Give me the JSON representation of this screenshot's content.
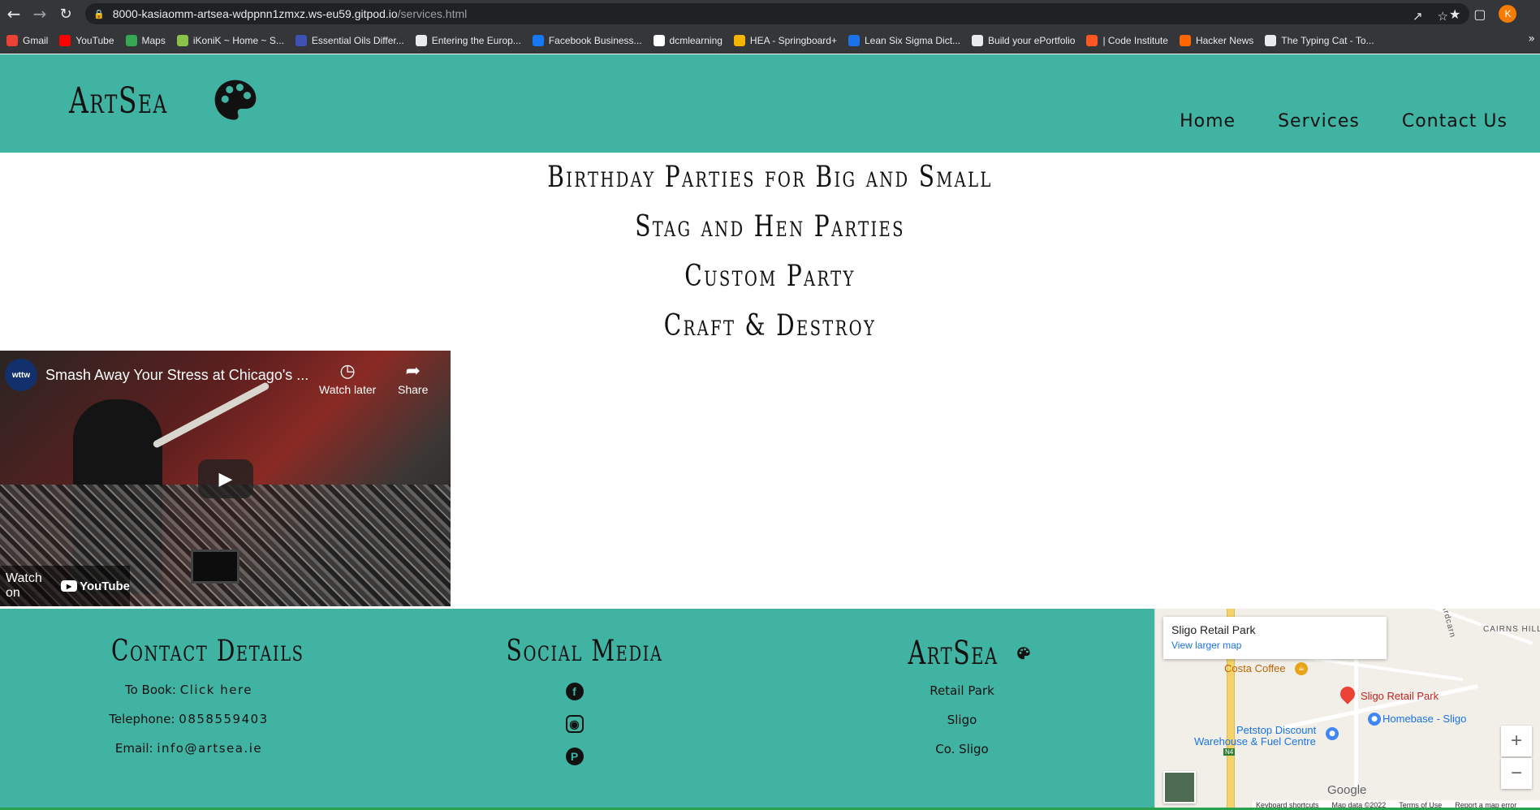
{
  "browser": {
    "url_host": "8000-kasiaomm-artsea-wdppnn1zmxz.ws-eu59.gitpod.io",
    "url_path": "/services.html",
    "profile_initial": "K",
    "bookmarks": [
      {
        "label": "Gmail",
        "color": "#ea4335"
      },
      {
        "label": "YouTube",
        "color": "#ff0000"
      },
      {
        "label": "Maps",
        "color": "#34a853"
      },
      {
        "label": "iKoniK ~ Home ~ S...",
        "color": "#8bc34a"
      },
      {
        "label": "Essential Oils Differ...",
        "color": "#3f51b5"
      },
      {
        "label": "Entering the Europ...",
        "color": "#e8eaed"
      },
      {
        "label": "Facebook Business...",
        "color": "#1877f2"
      },
      {
        "label": "dcmlearning",
        "color": "#ffffff"
      },
      {
        "label": "HEA - Springboard+",
        "color": "#f4b400"
      },
      {
        "label": "Lean Six Sigma Dict...",
        "color": "#1a73e8"
      },
      {
        "label": "Build your ePortfolio",
        "color": "#e8eaed"
      },
      {
        "label": "| Code Institute",
        "color": "#ff5722"
      },
      {
        "label": "Hacker News",
        "color": "#ff6600"
      },
      {
        "label": "The Typing Cat - To...",
        "color": "#e8eaed"
      }
    ]
  },
  "header": {
    "brand": "ArtSea",
    "nav": [
      "Home",
      "Services",
      "Contact Us"
    ]
  },
  "services": [
    "Birthday Parties for Big and Small",
    "Stag and Hen Parties",
    "Custom Party",
    "Craft & Destroy"
  ],
  "video": {
    "channel": "wttw",
    "title": "Smash Away Your Stress at Chicago's ...",
    "watch_later": "Watch later",
    "share": "Share",
    "watch_on": "Watch on",
    "youtube": "YouTube"
  },
  "footer": {
    "contact": {
      "heading": "Contact Details",
      "book_label": "To Book:",
      "book_link": "Click here",
      "phone_label": "Telephone:",
      "phone": "0858559403",
      "email_label": "Email:",
      "email": "info@artsea.ie"
    },
    "social": {
      "heading": "Social Media"
    },
    "address": {
      "brand": "ArtSea",
      "lines": [
        "Retail Park",
        "Sligo",
        "Co. Sligo"
      ]
    }
  },
  "map": {
    "place": "Sligo Retail Park",
    "larger": "View larger map",
    "pois": [
      "Costa Coffee",
      "Sligo Retail Park",
      "Homebase - Sligo",
      "Petstop Discount",
      "Warehouse & Fuel Centre",
      "CAIRNS HILL",
      "Ardcarn",
      "N4"
    ],
    "google": "Google",
    "attrib": [
      "Keyboard shortcuts",
      "Map data ©2022",
      "Terms of Use",
      "Report a map error"
    ]
  },
  "colors": {
    "teal": "#40b3a2",
    "chrome": "#35363a"
  }
}
